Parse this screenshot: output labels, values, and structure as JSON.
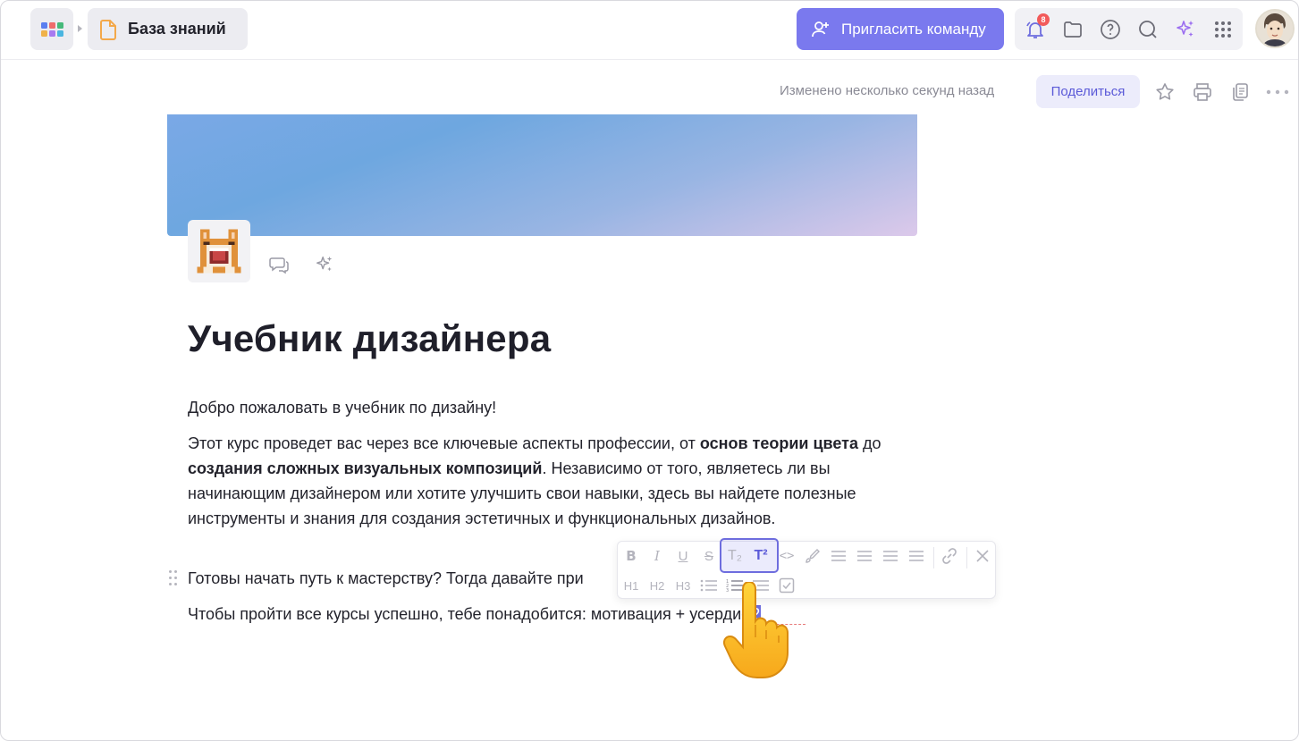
{
  "topbar": {
    "breadcrumb_title": "База знаний",
    "invite_label": "Пригласить команду",
    "notifications_count": "8"
  },
  "doc_header": {
    "modified_text": "Изменено несколько секунд назад",
    "share_label": "Поделиться"
  },
  "document": {
    "title": "Учебник дизайнера",
    "p1": "Добро пожаловать в учебник по дизайну!",
    "p2": {
      "t1": "Этот курс проведет вас через все ключевые аспекты профессии, от ",
      "b1": "основ теории цвета",
      "t2": " до ",
      "b2": "создания сложных визуальных композиций",
      "t3": ". Независимо от того, являетесь ли вы начинающим дизайнером или хотите улучшить свои навыки, здесь вы найдете полезные инструменты и знания для создания эстетичных и функциональных дизайнов."
    },
    "p3": "Готовы начать путь к мастерству? Тогда давайте при",
    "p4_text": "Чтобы пройти все курсы успешно, тебе понадобится: мотивация + усердие",
    "p4_selected": "2"
  },
  "toolbar": {
    "row1": [
      "B",
      "I",
      "U",
      "S",
      "T₂",
      "T²",
      "<>",
      "brush",
      "align-left",
      "align-center",
      "align-right",
      "align-justify",
      "link",
      "clear"
    ],
    "row2": [
      "H1",
      "H2",
      "H3",
      "bullet-list",
      "numbered-list",
      "indent-list",
      "checklist"
    ]
  },
  "colors": {
    "accent": "#7a79ee",
    "accent_dark": "#5b5ad8",
    "badge": "#f25a5a"
  }
}
